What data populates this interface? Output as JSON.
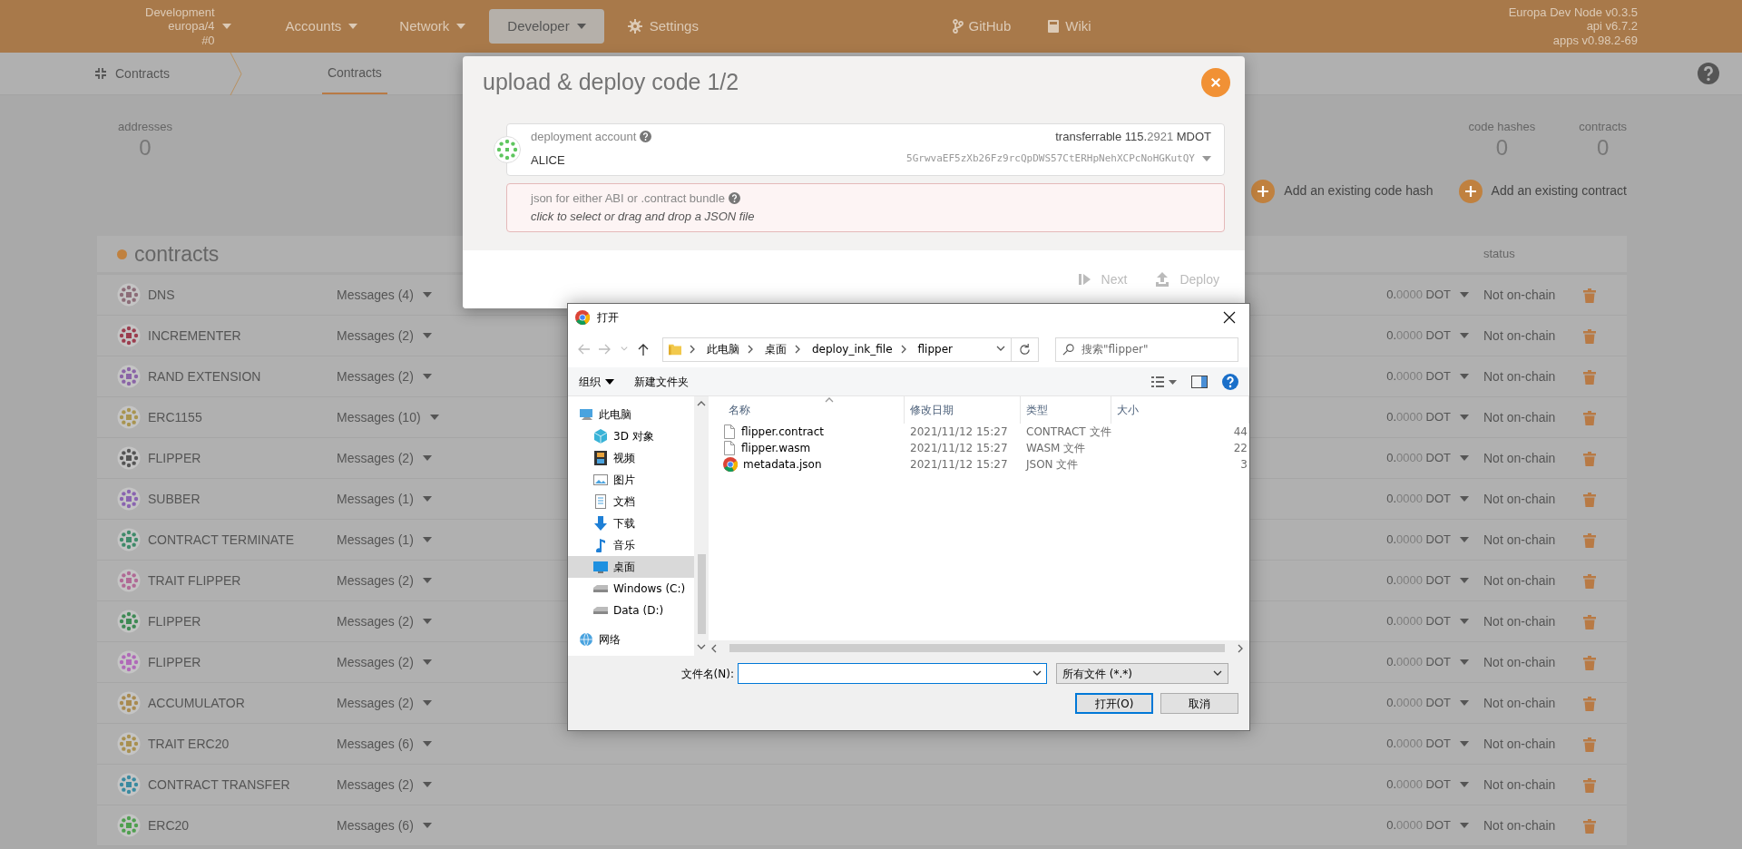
{
  "top_bar": {
    "chain": {
      "lines": [
        "Development",
        "europa/4",
        "#0"
      ]
    },
    "nav": [
      {
        "label": "Accounts",
        "kind": "menu",
        "selected": false
      },
      {
        "label": "Network",
        "kind": "menu",
        "selected": false
      },
      {
        "label": "Developer",
        "kind": "menu",
        "selected": true
      },
      {
        "label": "Settings",
        "kind": "settings",
        "selected": false
      }
    ],
    "links": [
      {
        "label": "GitHub",
        "kind": "repo"
      },
      {
        "label": "Wiki",
        "kind": "docs"
      }
    ],
    "version": [
      "Europa Dev Node v0.3.5",
      "api v6.7.2",
      "apps v0.98.2-69"
    ]
  },
  "sub_bar": {
    "section": "Contracts",
    "tabs": [
      {
        "label": "Contracts",
        "selected": true
      }
    ]
  },
  "summary": {
    "left": [
      {
        "label": "addresses",
        "value": "0"
      }
    ],
    "right": [
      {
        "label": "code hashes",
        "value": "0"
      },
      {
        "label": "contracts",
        "value": "0"
      }
    ]
  },
  "actions": [
    "Add an existing code hash",
    "Add an existing contract"
  ],
  "contracts": {
    "title": "contracts",
    "status_header": "status",
    "rows": [
      {
        "name": "DNS",
        "messages": "Messages (4)",
        "balance": "0.0000",
        "unit": "DOT",
        "status": "Not on-chain",
        "color": "#8c6d78"
      },
      {
        "name": "INCREMENTER",
        "messages": "Messages (2)",
        "balance": "0.0000",
        "unit": "DOT",
        "status": "Not on-chain",
        "color": "#9b3d4e"
      },
      {
        "name": "RAND EXTENSION",
        "messages": "Messages (2)",
        "balance": "0.0000",
        "unit": "DOT",
        "status": "Not on-chain",
        "color": "#8a64a6"
      },
      {
        "name": "ERC1155",
        "messages": "Messages (10)",
        "balance": "0.0000",
        "unit": "DOT",
        "status": "Not on-chain",
        "color": "#a89450"
      },
      {
        "name": "FLIPPER",
        "messages": "Messages (2)",
        "balance": "0.0000",
        "unit": "DOT",
        "status": "Not on-chain",
        "color": "#555555"
      },
      {
        "name": "SUBBER",
        "messages": "Messages (1)",
        "balance": "0.0000",
        "unit": "DOT",
        "status": "Not on-chain",
        "color": "#8a64b0"
      },
      {
        "name": "CONTRACT TERMINATE",
        "messages": "Messages (1)",
        "balance": "0.0000",
        "unit": "DOT",
        "status": "Not on-chain",
        "color": "#3f8a6a"
      },
      {
        "name": "TRAIT FLIPPER",
        "messages": "Messages (2)",
        "balance": "0.0000",
        "unit": "DOT",
        "status": "Not on-chain",
        "color": "#b06a95"
      },
      {
        "name": "FLIPPER",
        "messages": "Messages (2)",
        "balance": "0.0000",
        "unit": "DOT",
        "status": "Not on-chain",
        "color": "#3f8a55"
      },
      {
        "name": "FLIPPER",
        "messages": "Messages (2)",
        "balance": "0.0000",
        "unit": "DOT",
        "status": "Not on-chain",
        "color": "#b06ab8"
      },
      {
        "name": "ACCUMULATOR",
        "messages": "Messages (2)",
        "balance": "0.0000",
        "unit": "DOT",
        "status": "Not on-chain",
        "color": "#a88a50"
      },
      {
        "name": "TRAIT ERC20",
        "messages": "Messages (6)",
        "balance": "0.0000",
        "unit": "DOT",
        "status": "Not on-chain",
        "color": "#a89050"
      },
      {
        "name": "CONTRACT TRANSFER",
        "messages": "Messages (2)",
        "balance": "0.0000",
        "unit": "DOT",
        "status": "Not on-chain",
        "color": "#3a8aa0"
      },
      {
        "name": "ERC20",
        "messages": "Messages (6)",
        "balance": "0.0000",
        "unit": "DOT",
        "status": "Not on-chain",
        "color": "#4f9f4f"
      }
    ]
  },
  "modal": {
    "title": "upload & deploy code 1/2",
    "account": {
      "label": "deployment account",
      "name": "ALICE",
      "transferrable_label": "transferrable",
      "balance": "115.2921",
      "unit": "MDOT",
      "address": "5GrwvaEF5zXb26Fz9rcQpDWS57CtERHpNehXCPcNoHGKutQY"
    },
    "file_input": {
      "label": "json for either ABI or .contract bundle",
      "hint": "click to select or drag and drop a JSON file"
    },
    "buttons": [
      {
        "label": "Next",
        "kind": "next",
        "disabled": true
      },
      {
        "label": "Deploy",
        "kind": "deploy",
        "disabled": true
      }
    ]
  },
  "file_dialog": {
    "title": "打开",
    "path": [
      "此电脑",
      "桌面",
      "deploy_ink_file",
      "flipper"
    ],
    "search": {
      "placeholder": "搜索\"flipper\""
    },
    "toolbar": [
      {
        "label": "组织",
        "kind": "menu"
      },
      {
        "label": "新建文件夹",
        "kind": "button"
      }
    ],
    "nav": [
      {
        "label": "此电脑",
        "kind": "pc",
        "selected": false,
        "children": [
          {
            "label": "3D 对象",
            "kind": "cube",
            "selected": false
          },
          {
            "label": "视频",
            "kind": "video",
            "selected": false
          },
          {
            "label": "图片",
            "kind": "picture",
            "selected": false
          },
          {
            "label": "文档",
            "kind": "document",
            "selected": false
          },
          {
            "label": "下载",
            "kind": "download",
            "selected": false
          },
          {
            "label": "音乐",
            "kind": "music",
            "selected": false
          },
          {
            "label": "桌面",
            "kind": "desktop",
            "selected": true
          },
          {
            "label": "Windows (C:)",
            "kind": "drive",
            "selected": false
          },
          {
            "label": "Data (D:)",
            "kind": "drive",
            "selected": false
          }
        ]
      },
      {
        "label": "网络",
        "kind": "network",
        "selected": false
      }
    ],
    "columns": [
      "名称",
      "修改日期",
      "类型",
      "大小"
    ],
    "files": [
      {
        "name": "flipper.contract",
        "kind": "document",
        "modified": "2021/11/12 15:27",
        "type": "CONTRACT 文件",
        "size": "44"
      },
      {
        "name": "flipper.wasm",
        "kind": "document",
        "modified": "2021/11/12 15:27",
        "type": "WASM 文件",
        "size": "22"
      },
      {
        "name": "metadata.json",
        "kind": "web",
        "modified": "2021/11/12 15:27",
        "type": "JSON 文件",
        "size": "3"
      }
    ],
    "filename": {
      "label": "文件名(N):"
    },
    "filter": "所有文件 (*.*)",
    "buttons": [
      {
        "label": "打开(O)",
        "kind": "primary"
      },
      {
        "label": "取消",
        "kind": "secondary"
      }
    ]
  }
}
